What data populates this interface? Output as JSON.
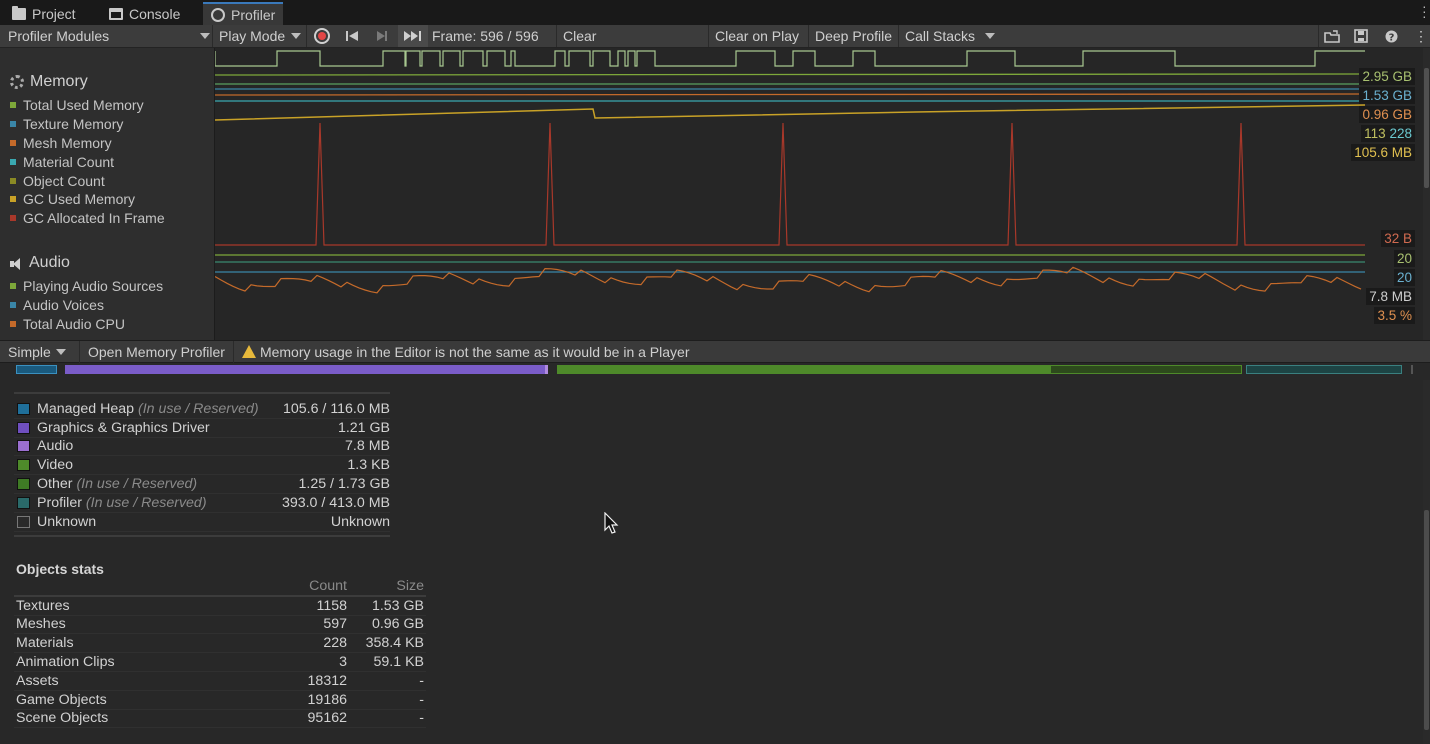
{
  "tabs": [
    {
      "label": "Project",
      "icon": "folder-icon"
    },
    {
      "label": "Console",
      "icon": "console-icon"
    },
    {
      "label": "Profiler",
      "icon": "profiler-icon"
    }
  ],
  "toolbar": {
    "modules_label": "Profiler Modules",
    "play_mode": "Play Mode",
    "frame": "Frame: 596 / 596",
    "clear": "Clear",
    "clear_on_play": "Clear on Play",
    "deep_profile": "Deep Profile",
    "call_stacks": "Call Stacks"
  },
  "memory_module": {
    "title": "Memory",
    "items": [
      {
        "label": "Total Used Memory",
        "color": "#7ea83a"
      },
      {
        "label": "Texture Memory",
        "color": "#3a86a8"
      },
      {
        "label": "Mesh Memory",
        "color": "#c46a2a"
      },
      {
        "label": "Material Count",
        "color": "#3aa8b0"
      },
      {
        "label": "Object Count",
        "color": "#8a8a24"
      },
      {
        "label": "GC Used Memory",
        "color": "#c9a227"
      },
      {
        "label": "GC Allocated In Frame",
        "color": "#a8382a"
      }
    ],
    "value_labels": [
      "2.95 GB",
      "1.53 GB",
      "0.96 GB",
      "113",
      "228",
      "105.6 MB",
      "32 B"
    ]
  },
  "audio_module": {
    "title": "Audio",
    "items": [
      {
        "label": "Playing Audio Sources",
        "color": "#7ea83a"
      },
      {
        "label": "Audio Voices",
        "color": "#3a86a8"
      },
      {
        "label": "Total Audio CPU",
        "color": "#c46a2a"
      }
    ],
    "value_labels": [
      "20",
      "20",
      "7.8 MB",
      "3.5 %"
    ]
  },
  "bottom_bar": {
    "view_mode": "Simple",
    "open_memory_profiler": "Open Memory Profiler",
    "warning": "Memory usage in the Editor is not the same as it would be in a Player"
  },
  "breakdown": [
    {
      "name": "Managed Heap",
      "hint": "(In use / Reserved)",
      "value": "105.6 / 116.0 MB",
      "color": "#1f6f9a"
    },
    {
      "name": "Graphics & Graphics Driver",
      "hint": "",
      "value": "1.21 GB",
      "color": "#6f4fbf"
    },
    {
      "name": "Audio",
      "hint": "",
      "value": "7.8 MB",
      "color": "#9b6fd0"
    },
    {
      "name": "Video",
      "hint": "",
      "value": "1.3 KB",
      "color": "#4e8a2a"
    },
    {
      "name": "Other",
      "hint": "(In use / Reserved)",
      "value": "1.25 / 1.73 GB",
      "color": "#3f7a25"
    },
    {
      "name": "Profiler",
      "hint": "(In use / Reserved)",
      "value": "393.0 / 413.0 MB",
      "color": "#2a6a6a"
    },
    {
      "name": "Unknown",
      "hint": "",
      "value": "Unknown",
      "color": "#2a2a2a"
    }
  ],
  "objects_stats": {
    "title": "Objects stats",
    "headers": [
      "",
      "Count",
      "Size"
    ],
    "rows": [
      {
        "name": "Textures",
        "count": "1158",
        "size": "1.53 GB"
      },
      {
        "name": "Meshes",
        "count": "597",
        "size": "0.96 GB"
      },
      {
        "name": "Materials",
        "count": "228",
        "size": "358.4 KB"
      },
      {
        "name": "Animation Clips",
        "count": "3",
        "size": "59.1 KB"
      },
      {
        "name": "Assets",
        "count": "18312",
        "size": "-"
      },
      {
        "name": "Game Objects",
        "count": "19186",
        "size": "-"
      },
      {
        "name": "Scene Objects",
        "count": "95162",
        "size": "-"
      }
    ]
  }
}
